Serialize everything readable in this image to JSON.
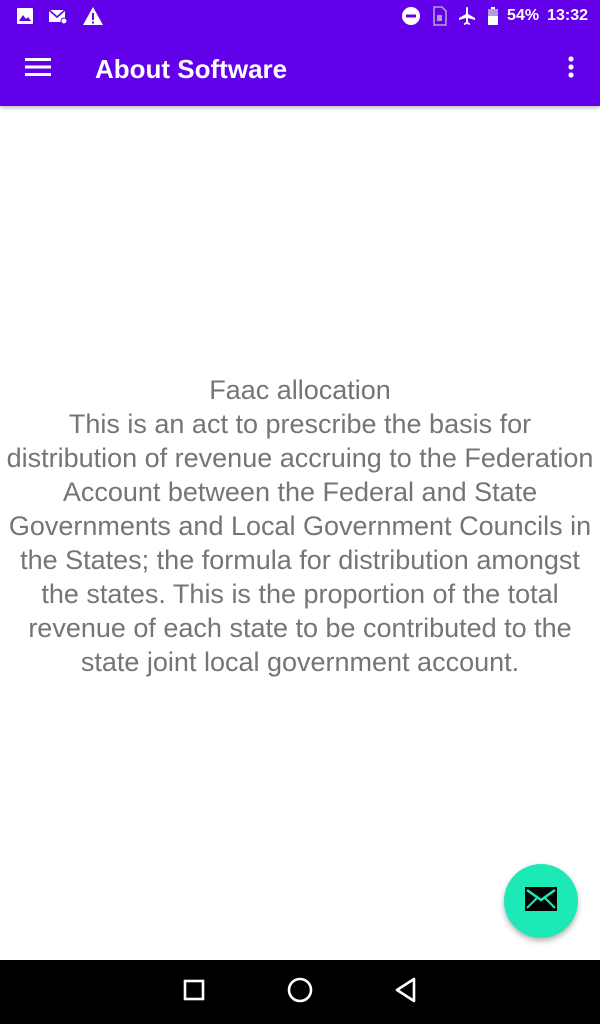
{
  "status_bar": {
    "left_icons": [
      "image-icon",
      "mail-icon",
      "warning-icon"
    ],
    "right_icons": [
      "do-not-disturb-icon",
      "sim-icon",
      "airplane-icon",
      "battery-icon"
    ],
    "battery": "54%",
    "time": "13:32"
  },
  "app_bar": {
    "title": "About Software",
    "menu_icon": "hamburger-menu-icon",
    "overflow_icon": "more-vert-icon"
  },
  "content": {
    "heading": "Faac allocation",
    "body": "This is an act to prescribe the basis for distribution of revenue accruing to the Federation Account between the Federal and State Governments and Local Government Councils in the States; the formula for distribution amongst the states. This is the proportion of the total revenue of each state to be contributed to the state joint local government account."
  },
  "fab": {
    "icon": "email-icon"
  },
  "nav_bar": {
    "buttons": [
      "recents-icon",
      "home-icon",
      "back-icon"
    ]
  },
  "colors": {
    "primary": "#6200ea",
    "accent": "#1de9b6",
    "text": "#757575"
  }
}
